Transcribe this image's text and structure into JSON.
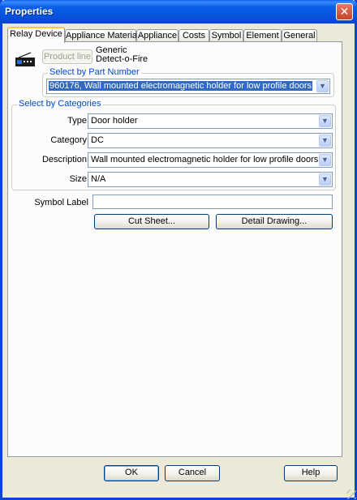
{
  "window": {
    "title": "Properties"
  },
  "tabs": [
    {
      "label": "Relay Device",
      "active": true
    },
    {
      "label": "Appliance Material",
      "active": false
    },
    {
      "label": "Appliance",
      "active": false
    },
    {
      "label": "Costs",
      "active": false
    },
    {
      "label": "Symbol",
      "active": false
    },
    {
      "label": "Element",
      "active": false
    },
    {
      "label": "General",
      "active": false
    }
  ],
  "device": {
    "icon": "relay-device-icon",
    "product_line_button": "Product line",
    "product_line_name": "Generic",
    "manufacturer": "Detect-o-Fire"
  },
  "part_number": {
    "group_label": "Select by Part Number",
    "value": "960176, Wall mounted electromagnetic holder for low profile doors"
  },
  "categories": {
    "group_label": "Select by Categories",
    "fields": [
      {
        "label": "Type",
        "value": "Door holder"
      },
      {
        "label": "Category",
        "value": "DC"
      },
      {
        "label": "Description",
        "value": "Wall mounted electromagnetic holder for low profile doors"
      },
      {
        "label": "Size",
        "value": "N/A"
      }
    ]
  },
  "symbol_label": {
    "label": "Symbol Label",
    "value": ""
  },
  "buttons": {
    "cut_sheet": "Cut Sheet...",
    "detail_drawing": "Detail Drawing...",
    "ok": "OK",
    "cancel": "Cancel",
    "help": "Help"
  }
}
